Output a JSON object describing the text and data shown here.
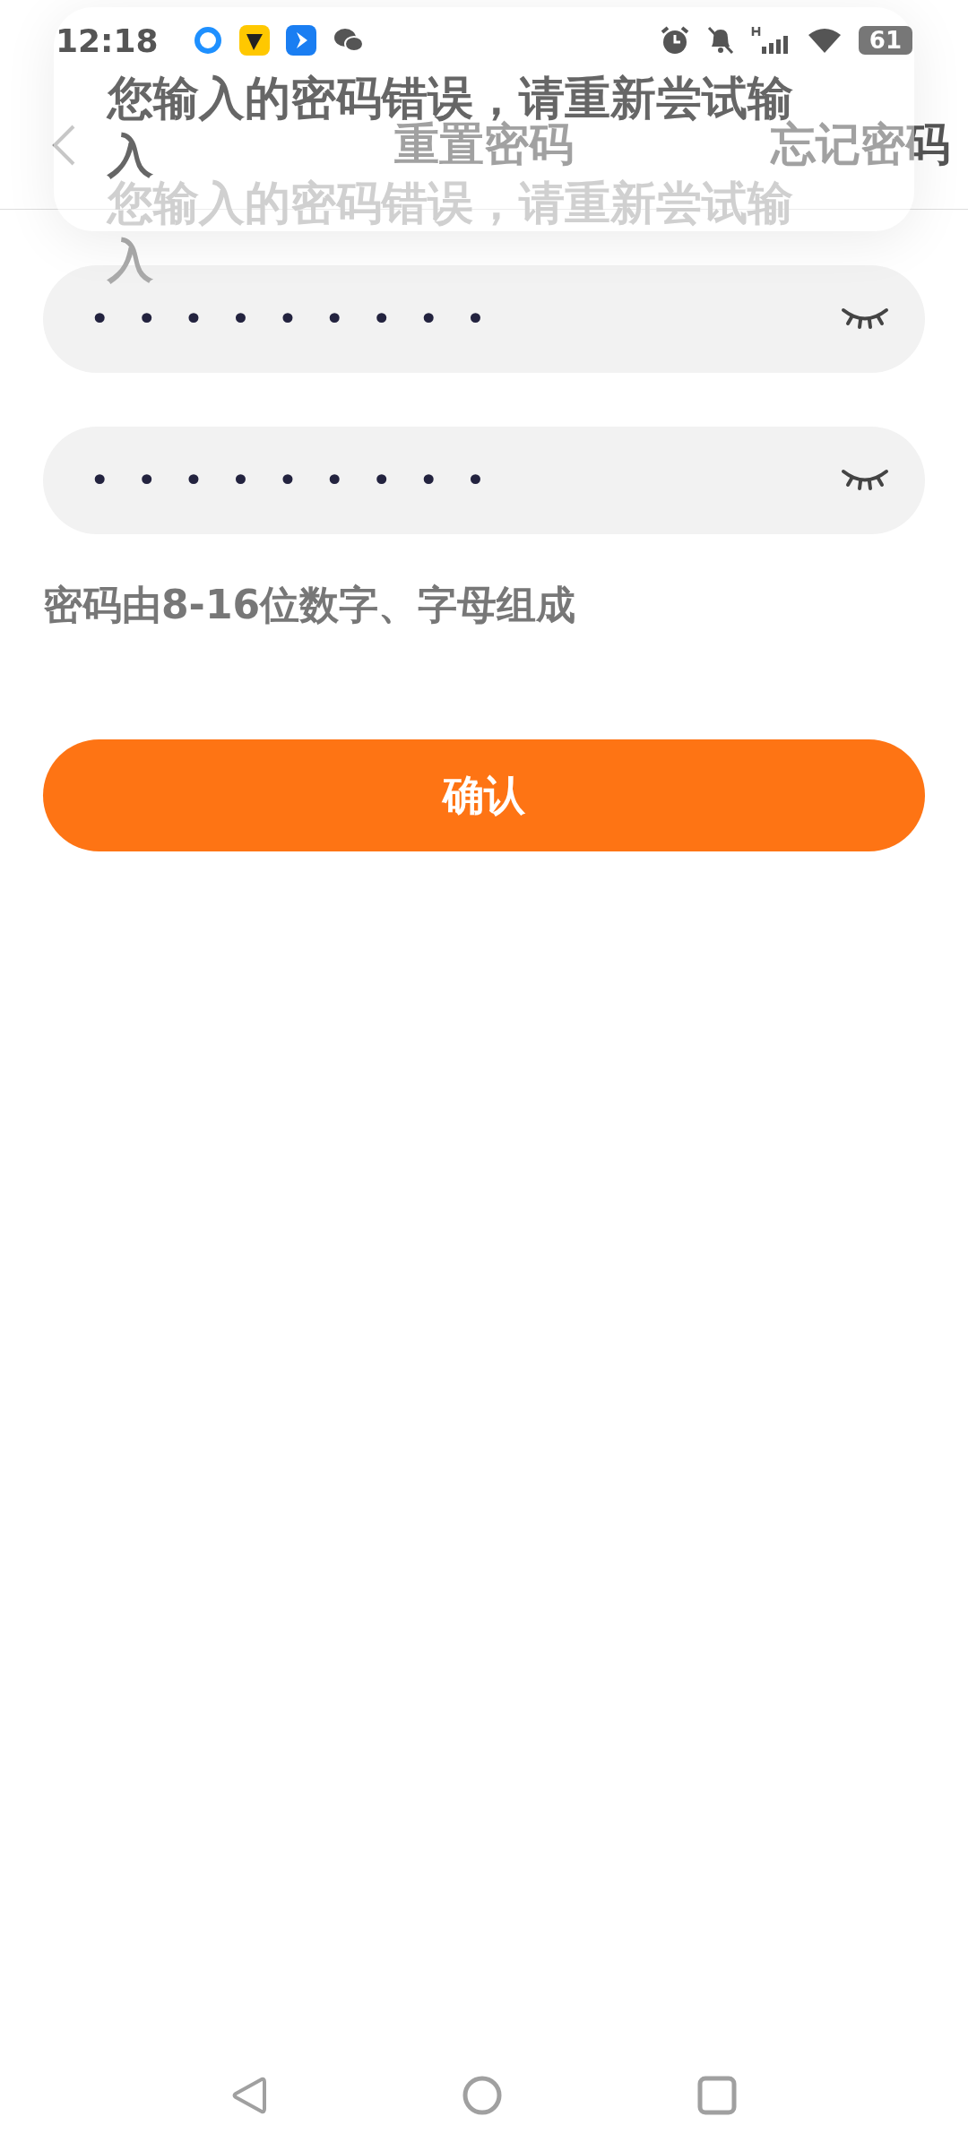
{
  "status_bar": {
    "time": "12:18",
    "battery": "61"
  },
  "nav_bar": {
    "title": "重置密码",
    "action": "忘记密码"
  },
  "toast": {
    "message_lines": [
      "您输入的密码错误，请重新尝试输",
      "入"
    ],
    "ghost_lines": [
      "您输入的密码错误，请重新尝试输",
      "入"
    ]
  },
  "fields": [
    {
      "value": "•••••••••"
    },
    {
      "value": "•••••••••"
    }
  ],
  "hint": "密码由8-16位数字、字母组成",
  "confirm_button": "确认"
}
